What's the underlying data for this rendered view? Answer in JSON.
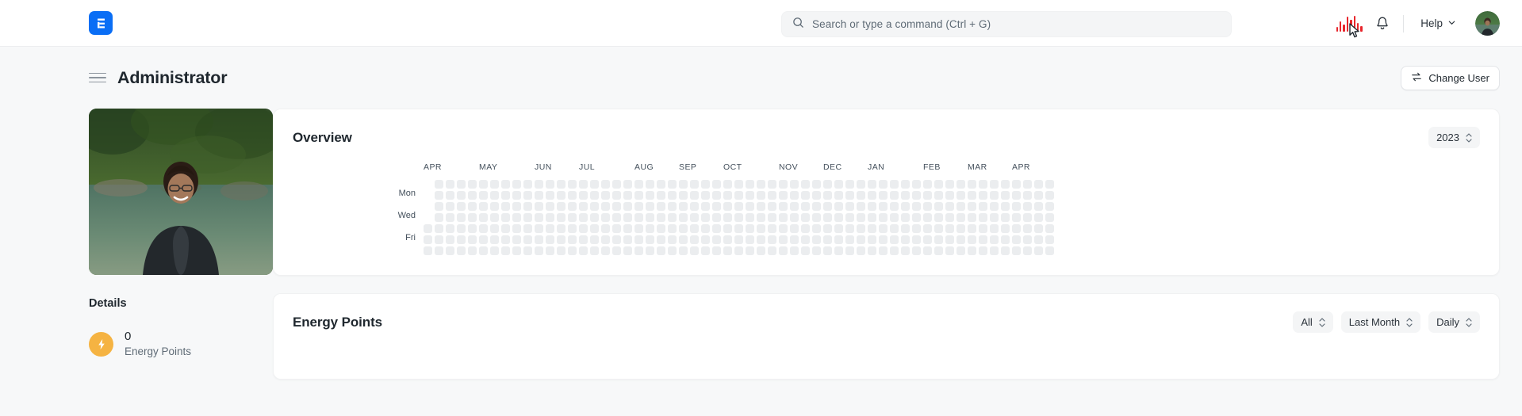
{
  "navbar": {
    "brand_icon": "frappe-logo-icon",
    "brand_color": "#0a6ef5",
    "search": {
      "placeholder": "Search or type a command (Ctrl + G)",
      "value": "",
      "icon": "search-icon"
    },
    "waveform_icon": "audio-waveform-icon",
    "waveform_color": "#e8262c",
    "notification_icon": "bell-icon",
    "help_label": "Help",
    "help_chevron": "chevron-down-icon",
    "avatar": "user-avatar"
  },
  "page_head": {
    "menu_icon": "hamburger-menu-icon",
    "title": "Administrator",
    "change_user": {
      "label": "Change User",
      "icon": "swap-arrows-icon"
    }
  },
  "sidebar": {
    "profile_image": "user-profile-photo",
    "details_heading": "Details",
    "stats": [
      {
        "icon": "lightning-bolt-icon",
        "icon_color": "#f5b342",
        "value": "0",
        "label": "Energy Points"
      }
    ]
  },
  "overview_card": {
    "title": "Overview",
    "year_select": {
      "value": "2023",
      "icon": "chevron-updown-icon"
    },
    "heatmap": {
      "day_labels": [
        "Mon",
        "Wed",
        "Fri"
      ],
      "months": [
        "APR",
        "MAY",
        "JUN",
        "JUL",
        "AUG",
        "SEP",
        "OCT",
        "NOV",
        "DEC",
        "JAN",
        "FEB",
        "MAR",
        "APR"
      ],
      "empty_color": "#ebedef",
      "weeks": 53,
      "rows": 7,
      "total_contributions": 0
    }
  },
  "energy_points_card": {
    "title": "Energy Points",
    "filters": [
      {
        "value": "All",
        "icon": "chevron-updown-icon"
      },
      {
        "value": "Last Month",
        "icon": "chevron-updown-icon"
      },
      {
        "value": "Daily",
        "icon": "chevron-updown-icon"
      }
    ]
  }
}
